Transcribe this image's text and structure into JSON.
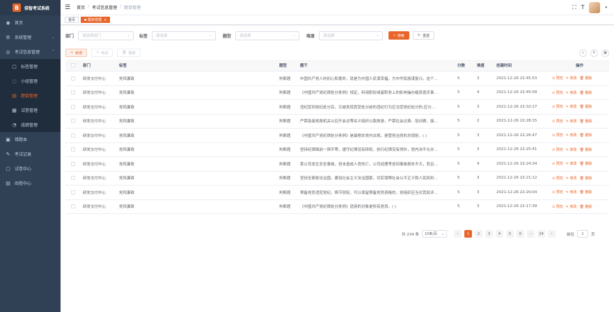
{
  "app": {
    "name": "倍智考试系统",
    "logo_glyph": "B"
  },
  "sidebar": {
    "items": [
      {
        "label": "首页",
        "icon": "dashboard-icon",
        "glyph": "◉"
      },
      {
        "label": "系统管理",
        "icon": "gear-icon",
        "glyph": "⚙",
        "arrow": "⌄"
      },
      {
        "label": "考试信息管理",
        "icon": "monitor-icon",
        "glyph": "◎",
        "arrow": "⌃"
      }
    ],
    "submenu": [
      {
        "label": "标签管理",
        "icon": "tag-icon",
        "glyph": "▢"
      },
      {
        "label": "小组管理",
        "icon": "group-icon",
        "glyph": "◌"
      },
      {
        "label": "题目管理",
        "icon": "question-icon",
        "glyph": "▤"
      },
      {
        "label": "试卷管理",
        "icon": "paper-icon",
        "glyph": "▦"
      },
      {
        "label": "成绩管理",
        "icon": "score-icon",
        "glyph": "◔"
      }
    ],
    "bottom_items": [
      {
        "label": "错题本",
        "icon": "book-icon",
        "glyph": "▣"
      },
      {
        "label": "考试记录",
        "icon": "record-icon",
        "glyph": "✎"
      },
      {
        "label": "试卷中心",
        "icon": "center-icon",
        "glyph": "▢"
      },
      {
        "label": "阅卷中心",
        "icon": "grading-icon",
        "glyph": "▤"
      }
    ]
  },
  "navbar": {
    "hamburger": "☰",
    "breadcrumb": [
      "首页",
      "考试信息管理",
      "题目管理"
    ],
    "sep": "/",
    "fullscreen_glyph": "⛶",
    "fontsize_glyph": "T",
    "caret": "▾"
  },
  "tags": [
    {
      "label": "首页"
    },
    {
      "label": "题目管理",
      "close": "×"
    }
  ],
  "filters": {
    "dept_label": "部门",
    "dept_placeholder": "请选择部门",
    "tag_label": "标签",
    "tag_placeholder": "请选择",
    "type_label": "题型",
    "type_placeholder": "请选择",
    "diff_label": "难度",
    "diff_placeholder": "请选择",
    "search_label": "搜索",
    "search_glyph": "⌕",
    "reset_label": "重置",
    "reset_glyph": "↻"
  },
  "toolbar": {
    "add_label": "新增",
    "add_glyph": "+",
    "edit_label": "修改",
    "edit_glyph": "✎",
    "delete_label": "删除",
    "delete_glyph": "🗑",
    "search_glyph": "⌕",
    "refresh_glyph": "↻",
    "columns_glyph": "▦"
  },
  "table": {
    "columns": [
      "部门",
      "标签",
      "题型",
      "题干",
      "分数",
      "难度",
      "创建时间",
      "操作"
    ],
    "ops": [
      "⊙ 预览",
      "✎ 修改",
      "🗑 删除"
    ],
    "rows": [
      {
        "dept": "研发交付中心",
        "tag": "党风廉政",
        "type": "判断题",
        "title": "中国共产党人的初心和使命，就是为中国人民谋幸福，为中华民族谋复兴。这个…",
        "score": "5",
        "diff": "3",
        "time": "2021-12-26 22:45:53"
      },
      {
        "dept": "研发交付中心",
        "tag": "党风廉政",
        "type": "判断题",
        "title": "《中国共产党纪律处分条例》规定，利用职权或者职务上的影响操办婚丧喜庆事…",
        "score": "5",
        "diff": "4",
        "time": "2021-12-26 22:45:09"
      },
      {
        "dept": "研发交付中心",
        "tag": "党风廉政",
        "type": "判断题",
        "title": "违纪受到党纪处分后，又被发现其受处分前的违纪行为应当受党纪处分的,应分…",
        "score": "5",
        "diff": "3",
        "time": "2021-12-26 22:32:27"
      },
      {
        "dept": "研发交付中心",
        "tag": "党风廉政",
        "type": "判断题",
        "title": "严禁各级党政机关以召开会议等名义组织公款旅游，严禁在会议费、培训费、接…",
        "score": "5",
        "diff": "2",
        "time": "2021-12-26 22:28:15"
      },
      {
        "dept": "研发交付中心",
        "tag": "党风廉政",
        "type": "判断题",
        "title": "《中国共产党纪律处分条例》是最根本党内法规，是管党治党的总规矩。( )",
        "score": "5",
        "diff": "3",
        "time": "2021-12-26 22:26:47"
      },
      {
        "dept": "研发交付中心",
        "tag": "党风廉政",
        "type": "判断题",
        "title": "坚持纪律面前一律平等，遵守纪律没有特权，执行纪律没有例外，党内决不允许…",
        "score": "5",
        "diff": "3",
        "time": "2021-12-26 22:25:41"
      },
      {
        "dept": "研发交付中心",
        "tag": "党风廉政",
        "type": "判断题",
        "title": "某公司发生安全事故，但未造成人员伤亡，公司经理考虑到事故损失不大，而且…",
        "score": "5",
        "diff": "4",
        "time": "2021-12-26 22:24:34"
      },
      {
        "dept": "研发交付中心",
        "tag": "党风廉政",
        "type": "判断题",
        "title": "坚持全面依法治国，建设社会主义法治国家，切实保障社会公平正义和人民权利…",
        "score": "5",
        "diff": "3",
        "time": "2021-12-26 22:21:12"
      },
      {
        "dept": "研发交付中心",
        "tag": "党风廉政",
        "type": "判断题",
        "title": "预备党员违犯党纪，情节较轻，可以保留预备党员资格的，党组织应当对其批评…",
        "score": "5",
        "diff": "3",
        "time": "2021-12-26 22:20:04"
      },
      {
        "dept": "研发交付中心",
        "tag": "党风廉政",
        "type": "判断题",
        "title": "《中国共产党纪律处分条例》适用的对象是所有党员。( )",
        "score": "5",
        "diff": "3",
        "time": "2021-12-26 22:17:39"
      }
    ]
  },
  "pagination": {
    "total": "共 234 条",
    "page_size": "10条/页",
    "prev": "‹",
    "next": "›",
    "pages": [
      "1",
      "2",
      "3",
      "4",
      "5",
      "6",
      "···",
      "24"
    ],
    "goto_label": "前往",
    "goto_value": "1",
    "page_suffix": "页"
  },
  "colors": {
    "accent": "#e8652a",
    "sidebar": "#304156"
  }
}
